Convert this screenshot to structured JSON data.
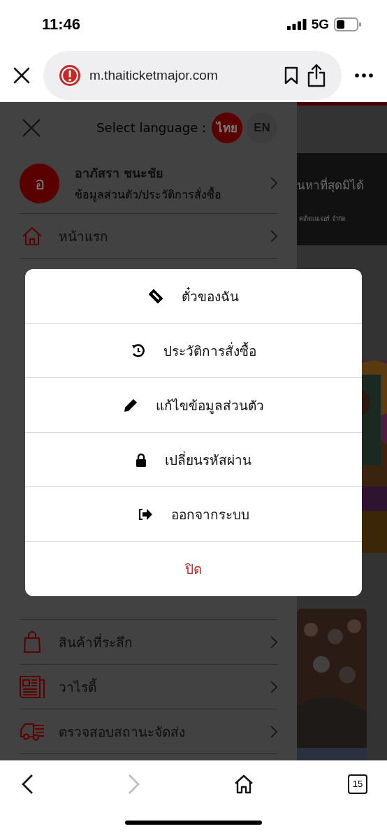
{
  "status_bar": {
    "time": "11:46",
    "network": "5G"
  },
  "browser": {
    "url": "m.thaiticketmajor.com"
  },
  "drawer": {
    "language_label": "Select language :",
    "languages": [
      {
        "label": "ไทย",
        "selected": true
      },
      {
        "label": "EN",
        "selected": false
      }
    ],
    "profile": {
      "initial": "อ",
      "name": "อาภัสรา ชนะชัย",
      "subtitle": "ข้อมูลส่วนตัว/ประวัติการสั่งซื้อ"
    },
    "items_top": [
      {
        "kind": "home",
        "label": "หน้าแรก"
      }
    ],
    "items_bottom": [
      {
        "kind": "bag",
        "label": "สินค้าที่ระลึก"
      },
      {
        "kind": "news",
        "label": "วาไรตี้"
      },
      {
        "kind": "truck",
        "label": "ตรวจสอบสถานะจัดส่ง"
      }
    ]
  },
  "page": {
    "banner_title": "นหาที่สุดมิได้",
    "banner_subtitle": "คเก็ตเมเจอร์ จำกัด"
  },
  "dialog": {
    "options": [
      {
        "kind": "ticket",
        "label": "ตั๋วของฉัน"
      },
      {
        "kind": "history",
        "label": "ประวัติการสั่งซื้อ"
      },
      {
        "kind": "edit",
        "label": "แก้ไขข้อมูลส่วนตัว"
      },
      {
        "kind": "lock",
        "label": "เปลี่ยนรหัสผ่าน"
      },
      {
        "kind": "logout",
        "label": "ออกจากระบบ"
      }
    ],
    "close": "ปิด"
  },
  "toolbar": {
    "back_disabled": false,
    "forward_disabled": true,
    "tab_count": "15"
  }
}
